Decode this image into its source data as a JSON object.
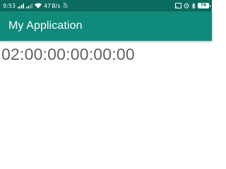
{
  "status_bar": {
    "time": "9:53",
    "net_speed_value": "47",
    "net_speed_unit": "B/s",
    "volte_top": "Vo",
    "volte_bottom": "LTE",
    "battery_level": "76",
    "background": "#0a6b61"
  },
  "icons": {
    "signal_1": "signal-icon",
    "signal_2": "signal-icon",
    "wifi": "wifi-icon",
    "cast": "cast-icon",
    "alarm": "alarm-icon",
    "bluetooth": "bluetooth-icon",
    "battery": "battery-icon"
  },
  "app_bar": {
    "title": "My Application",
    "background": "#0f8a7b"
  },
  "content": {
    "timer": "02:00:00:00:00:00"
  }
}
